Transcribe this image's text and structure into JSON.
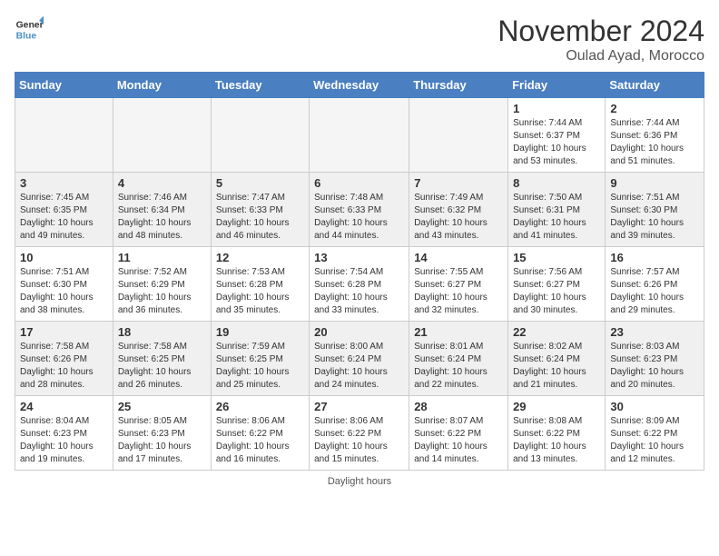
{
  "logo": {
    "general": "General",
    "blue": "Blue"
  },
  "title": "November 2024",
  "location": "Oulad Ayad, Morocco",
  "weekdays": [
    "Sunday",
    "Monday",
    "Tuesday",
    "Wednesday",
    "Thursday",
    "Friday",
    "Saturday"
  ],
  "footer": "Daylight hours",
  "weeks": [
    [
      {
        "day": "",
        "info": ""
      },
      {
        "day": "",
        "info": ""
      },
      {
        "day": "",
        "info": ""
      },
      {
        "day": "",
        "info": ""
      },
      {
        "day": "",
        "info": ""
      },
      {
        "day": "1",
        "info": "Sunrise: 7:44 AM\nSunset: 6:37 PM\nDaylight: 10 hours and 53 minutes."
      },
      {
        "day": "2",
        "info": "Sunrise: 7:44 AM\nSunset: 6:36 PM\nDaylight: 10 hours and 51 minutes."
      }
    ],
    [
      {
        "day": "3",
        "info": "Sunrise: 7:45 AM\nSunset: 6:35 PM\nDaylight: 10 hours and 49 minutes."
      },
      {
        "day": "4",
        "info": "Sunrise: 7:46 AM\nSunset: 6:34 PM\nDaylight: 10 hours and 48 minutes."
      },
      {
        "day": "5",
        "info": "Sunrise: 7:47 AM\nSunset: 6:33 PM\nDaylight: 10 hours and 46 minutes."
      },
      {
        "day": "6",
        "info": "Sunrise: 7:48 AM\nSunset: 6:33 PM\nDaylight: 10 hours and 44 minutes."
      },
      {
        "day": "7",
        "info": "Sunrise: 7:49 AM\nSunset: 6:32 PM\nDaylight: 10 hours and 43 minutes."
      },
      {
        "day": "8",
        "info": "Sunrise: 7:50 AM\nSunset: 6:31 PM\nDaylight: 10 hours and 41 minutes."
      },
      {
        "day": "9",
        "info": "Sunrise: 7:51 AM\nSunset: 6:30 PM\nDaylight: 10 hours and 39 minutes."
      }
    ],
    [
      {
        "day": "10",
        "info": "Sunrise: 7:51 AM\nSunset: 6:30 PM\nDaylight: 10 hours and 38 minutes."
      },
      {
        "day": "11",
        "info": "Sunrise: 7:52 AM\nSunset: 6:29 PM\nDaylight: 10 hours and 36 minutes."
      },
      {
        "day": "12",
        "info": "Sunrise: 7:53 AM\nSunset: 6:28 PM\nDaylight: 10 hours and 35 minutes."
      },
      {
        "day": "13",
        "info": "Sunrise: 7:54 AM\nSunset: 6:28 PM\nDaylight: 10 hours and 33 minutes."
      },
      {
        "day": "14",
        "info": "Sunrise: 7:55 AM\nSunset: 6:27 PM\nDaylight: 10 hours and 32 minutes."
      },
      {
        "day": "15",
        "info": "Sunrise: 7:56 AM\nSunset: 6:27 PM\nDaylight: 10 hours and 30 minutes."
      },
      {
        "day": "16",
        "info": "Sunrise: 7:57 AM\nSunset: 6:26 PM\nDaylight: 10 hours and 29 minutes."
      }
    ],
    [
      {
        "day": "17",
        "info": "Sunrise: 7:58 AM\nSunset: 6:26 PM\nDaylight: 10 hours and 28 minutes."
      },
      {
        "day": "18",
        "info": "Sunrise: 7:58 AM\nSunset: 6:25 PM\nDaylight: 10 hours and 26 minutes."
      },
      {
        "day": "19",
        "info": "Sunrise: 7:59 AM\nSunset: 6:25 PM\nDaylight: 10 hours and 25 minutes."
      },
      {
        "day": "20",
        "info": "Sunrise: 8:00 AM\nSunset: 6:24 PM\nDaylight: 10 hours and 24 minutes."
      },
      {
        "day": "21",
        "info": "Sunrise: 8:01 AM\nSunset: 6:24 PM\nDaylight: 10 hours and 22 minutes."
      },
      {
        "day": "22",
        "info": "Sunrise: 8:02 AM\nSunset: 6:24 PM\nDaylight: 10 hours and 21 minutes."
      },
      {
        "day": "23",
        "info": "Sunrise: 8:03 AM\nSunset: 6:23 PM\nDaylight: 10 hours and 20 minutes."
      }
    ],
    [
      {
        "day": "24",
        "info": "Sunrise: 8:04 AM\nSunset: 6:23 PM\nDaylight: 10 hours and 19 minutes."
      },
      {
        "day": "25",
        "info": "Sunrise: 8:05 AM\nSunset: 6:23 PM\nDaylight: 10 hours and 17 minutes."
      },
      {
        "day": "26",
        "info": "Sunrise: 8:06 AM\nSunset: 6:22 PM\nDaylight: 10 hours and 16 minutes."
      },
      {
        "day": "27",
        "info": "Sunrise: 8:06 AM\nSunset: 6:22 PM\nDaylight: 10 hours and 15 minutes."
      },
      {
        "day": "28",
        "info": "Sunrise: 8:07 AM\nSunset: 6:22 PM\nDaylight: 10 hours and 14 minutes."
      },
      {
        "day": "29",
        "info": "Sunrise: 8:08 AM\nSunset: 6:22 PM\nDaylight: 10 hours and 13 minutes."
      },
      {
        "day": "30",
        "info": "Sunrise: 8:09 AM\nSunset: 6:22 PM\nDaylight: 10 hours and 12 minutes."
      }
    ]
  ]
}
